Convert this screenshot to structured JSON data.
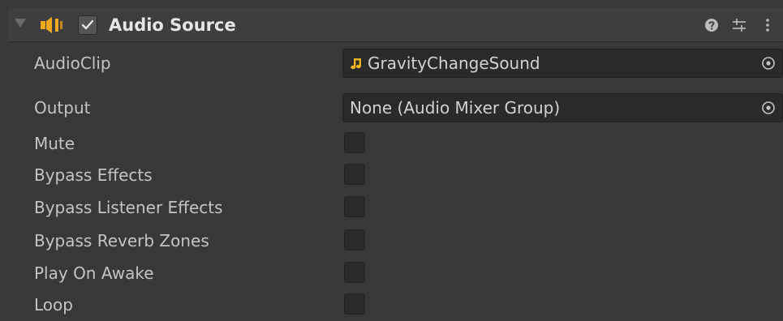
{
  "component": {
    "title": "Audio Source",
    "enabled": true
  },
  "header_icons": [
    "help-icon",
    "presets-icon",
    "menu-icon"
  ],
  "fields": {
    "audio_clip": {
      "label": "AudioClip",
      "value": "GravityChangeSound",
      "icon": "audio-clip-icon"
    },
    "output": {
      "label": "Output",
      "value": "None (Audio Mixer Group)"
    },
    "mute": {
      "label": "Mute",
      "checked": false
    },
    "bypass_effects": {
      "label": "Bypass Effects",
      "checked": false
    },
    "bypass_listener_effects": {
      "label": "Bypass Listener Effects",
      "checked": false
    },
    "bypass_reverb_zones": {
      "label": "Bypass Reverb Zones",
      "checked": false
    },
    "play_on_awake": {
      "label": "Play On Awake",
      "checked": false
    },
    "loop": {
      "label": "Loop",
      "checked": false
    }
  },
  "colors": {
    "background": "#383838",
    "header": "#3e3e3e",
    "field": "#2a2a2a",
    "text": "#c4c4c4",
    "speaker_icon": "#f0a81c",
    "audio_clip_icon": "#f2b320"
  }
}
